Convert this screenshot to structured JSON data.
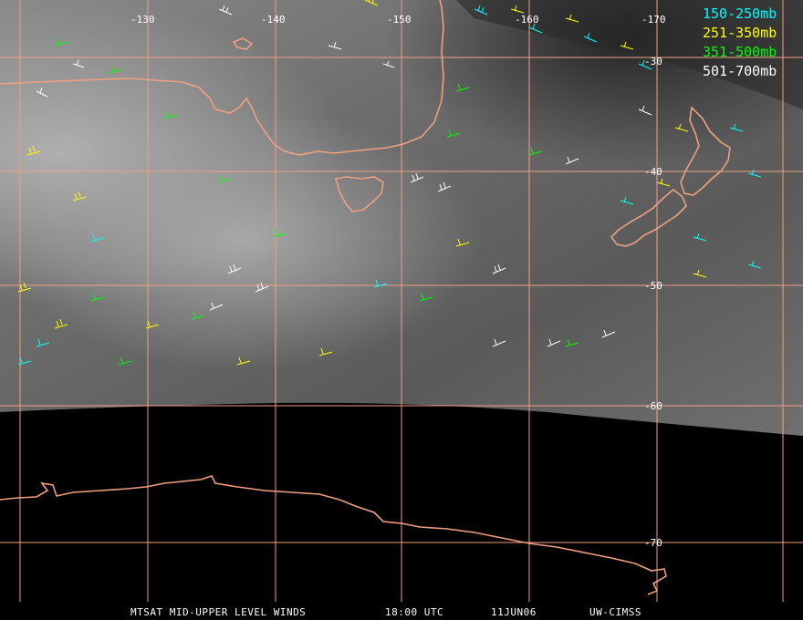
{
  "map": {
    "coast_color": "#f0a080",
    "grid_color": "#f0a080",
    "lon_labels": [
      "-130",
      "-140",
      "-150",
      "-160",
      "-170"
    ],
    "lat_labels": [
      "-30",
      "-40",
      "-50",
      "-60",
      "-70"
    ]
  },
  "legend": [
    {
      "label": "150-250mb",
      "color": "#00ffff"
    },
    {
      "label": "251-350mb",
      "color": "#ffff00"
    },
    {
      "label": "351-500mb",
      "color": "#00ff00"
    },
    {
      "label": "501-700mb",
      "color": "#ffffff"
    }
  ],
  "footer": {
    "product": "MTSAT MID-UPPER LEVEL WINDS",
    "time": "18:00 UTC",
    "date": "11JUN06",
    "source": "UW-CIMSS"
  }
}
